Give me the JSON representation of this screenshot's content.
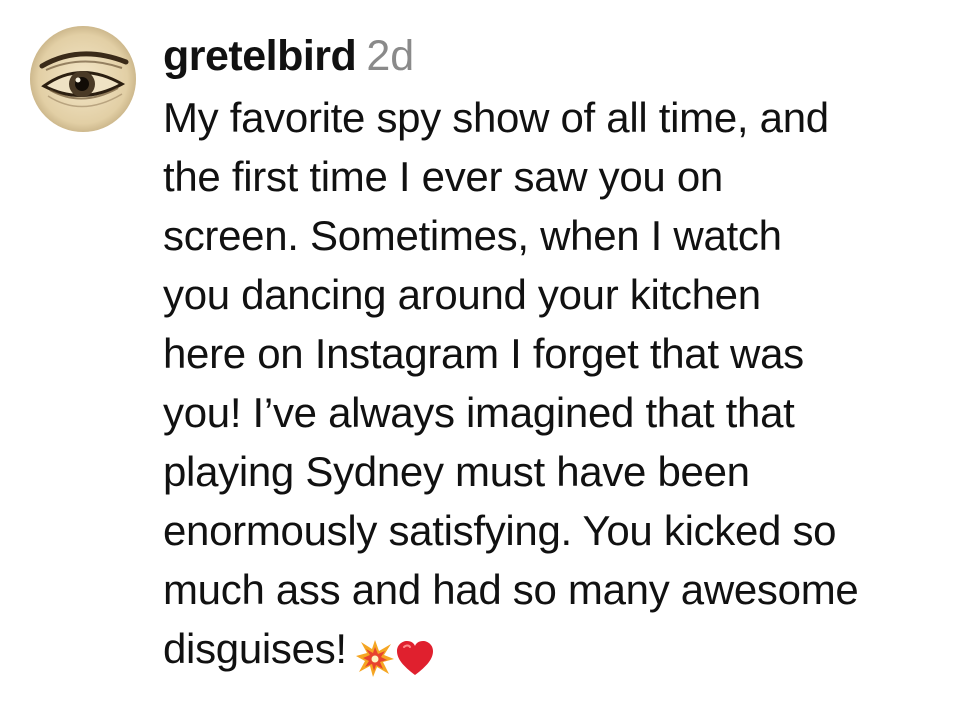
{
  "comment": {
    "username": "gretelbird",
    "timestamp": "2d",
    "lines": [
      "My favorite spy show of all time, and",
      "the first time I ever saw you on",
      "screen. Sometimes, when I watch",
      "you dancing around your kitchen",
      "here on Instagram I forget that was",
      "you! I’ve always imagined that that",
      "playing Sydney must have been",
      "enormously satisfying. You kicked so",
      "much ass and had so many awesome",
      "disguises!"
    ],
    "emojis": [
      "collision-icon",
      "red-heart-icon"
    ],
    "avatar_icon": "eye-illustration-avatar"
  },
  "colors": {
    "text": "#111111",
    "timestamp": "#8a8a8a",
    "heart": "#e0202e",
    "collision": "#f5a623"
  }
}
